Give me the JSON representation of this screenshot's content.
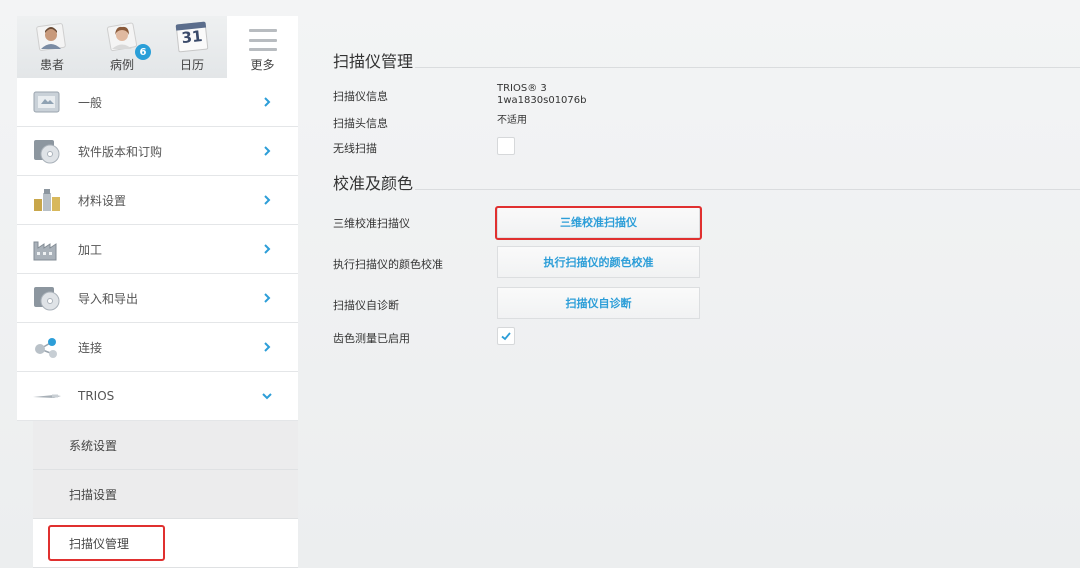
{
  "nav": {
    "tabs": [
      {
        "label": "患者",
        "icon": "patient-icon"
      },
      {
        "label": "病例",
        "icon": "case-icon",
        "badge": "6"
      },
      {
        "label": "日历",
        "icon": "calendar-icon",
        "calendar_day": "31"
      },
      {
        "label": "更多",
        "icon": "menu-icon",
        "active": true
      }
    ]
  },
  "sidebar": {
    "items": [
      {
        "label": "一般",
        "icon": "general-icon"
      },
      {
        "label": "软件版本和订购",
        "icon": "software-disc-icon"
      },
      {
        "label": "材料设置",
        "icon": "materials-icon"
      },
      {
        "label": "加工",
        "icon": "factory-icon"
      },
      {
        "label": "导入和导出",
        "icon": "import-export-disc-icon"
      },
      {
        "label": "连接",
        "icon": "connection-icon"
      },
      {
        "label": "TRIOS",
        "icon": "scanner-wand-icon",
        "expanded": true
      }
    ],
    "subitems": [
      {
        "label": "系统设置"
      },
      {
        "label": "扫描设置"
      },
      {
        "label": "扫描仪管理",
        "active": true
      }
    ]
  },
  "main": {
    "scanner_section_title": "扫描仪管理",
    "scanner_info_label": "扫描仪信息",
    "scanner_info_value_line1": "TRIOS® 3",
    "scanner_info_value_line2": "1wa1830s01076b",
    "scan_head_label": "扫描头信息",
    "scan_head_value": "不适用",
    "wireless_label": "无线扫描",
    "wireless_checked": false,
    "calibration_section_title": "校准及颜色",
    "calib3d_label": "三维校准扫描仪",
    "calib3d_button": "三维校准扫描仪",
    "color_calib_label": "执行扫描仪的颜色校准",
    "color_calib_button": "执行扫描仪的颜色校准",
    "self_diag_label": "扫描仪自诊断",
    "self_diag_button": "扫描仪自诊断",
    "shade_label": "齿色测量已启用",
    "shade_checked": true
  },
  "colors": {
    "accent": "#2d9ed8",
    "highlight": "#e0302f"
  }
}
